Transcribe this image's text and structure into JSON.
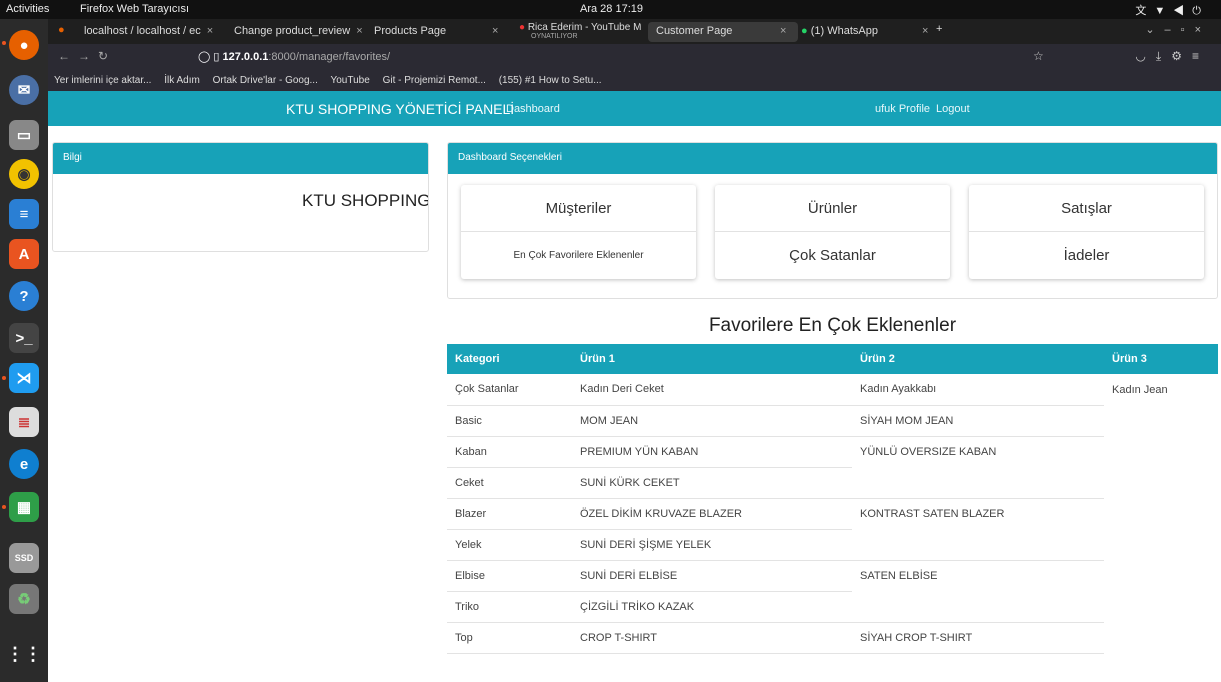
{
  "system": {
    "activities": "Activities",
    "app_name": "Firefox Web Tarayıcısı",
    "clock": "Ara 28 17:19"
  },
  "browser": {
    "tabs": [
      {
        "label": "localhost / localhost / ec"
      },
      {
        "label": "Change product_review"
      },
      {
        "label": "Products Page"
      },
      {
        "label": "Rica Ederim - YouTube M"
      },
      {
        "label": "Customer Page"
      },
      {
        "label": "(1) WhatsApp"
      }
    ],
    "tab_sub": "OYNATILIYOR",
    "url_host": "127.0.0.1",
    "url_rest": ":8000/manager/favorites/",
    "bookmarks": [
      "Yer imlerini içe aktar...",
      "İlk Adım",
      "Ortak Drive'lar - Goog...",
      "YouTube",
      "Git - Projemizi Remot...",
      "(155) #1 How to Setu..."
    ]
  },
  "nav": {
    "brand": "KTU SHOPPING YÖNETİCİ PANELİ",
    "dashboard": "Dashboard",
    "user": "ufuk Profile",
    "logout": "Logout"
  },
  "info_card": {
    "header": "Bilgi",
    "text": "KTU SHOPPING"
  },
  "dash_card": {
    "header": "Dashboard Seçenekleri",
    "options": [
      {
        "top": "Müşteriler",
        "bottom": "En Çok Favorilere Eklenenler"
      },
      {
        "top": "Ürünler",
        "bottom": "Çok Satanlar"
      },
      {
        "top": "Satışlar",
        "bottom": "İadeler"
      }
    ]
  },
  "favorites": {
    "title": "Favorilere En Çok Eklenenler",
    "headers": [
      "Kategori",
      "Ürün 1",
      "Ürün 2",
      "Ürün 3"
    ],
    "rows": [
      [
        "Çok Satanlar",
        "Kadın Deri Ceket",
        "Kadın Ayakkabı",
        "Kadın Jean"
      ],
      [
        "Basic",
        "MOM JEAN",
        "SİYAH MOM JEAN",
        ""
      ],
      [
        "Kaban",
        "PREMIUM YÜN KABAN",
        "YÜNLÜ OVERSIZE KABAN",
        ""
      ],
      [
        "Ceket",
        "SUNİ KÜRK CEKET",
        "",
        ""
      ],
      [
        "Blazer",
        "ÖZEL DİKİM KRUVAZE BLAZER",
        "KONTRAST SATEN BLAZER",
        ""
      ],
      [
        "Yelek",
        "SUNİ DERİ ŞİŞME YELEK",
        "",
        ""
      ],
      [
        "Elbise",
        "SUNİ DERİ ELBİSE",
        "SATEN ELBİSE",
        ""
      ],
      [
        "Triko",
        "ÇİZGİLİ TRİKO KAZAK",
        "",
        ""
      ],
      [
        "Top",
        "CROP T-SHIRT",
        "SİYAH CROP T-SHIRT",
        ""
      ]
    ]
  },
  "colors": {
    "primary": "#17a2b8"
  }
}
